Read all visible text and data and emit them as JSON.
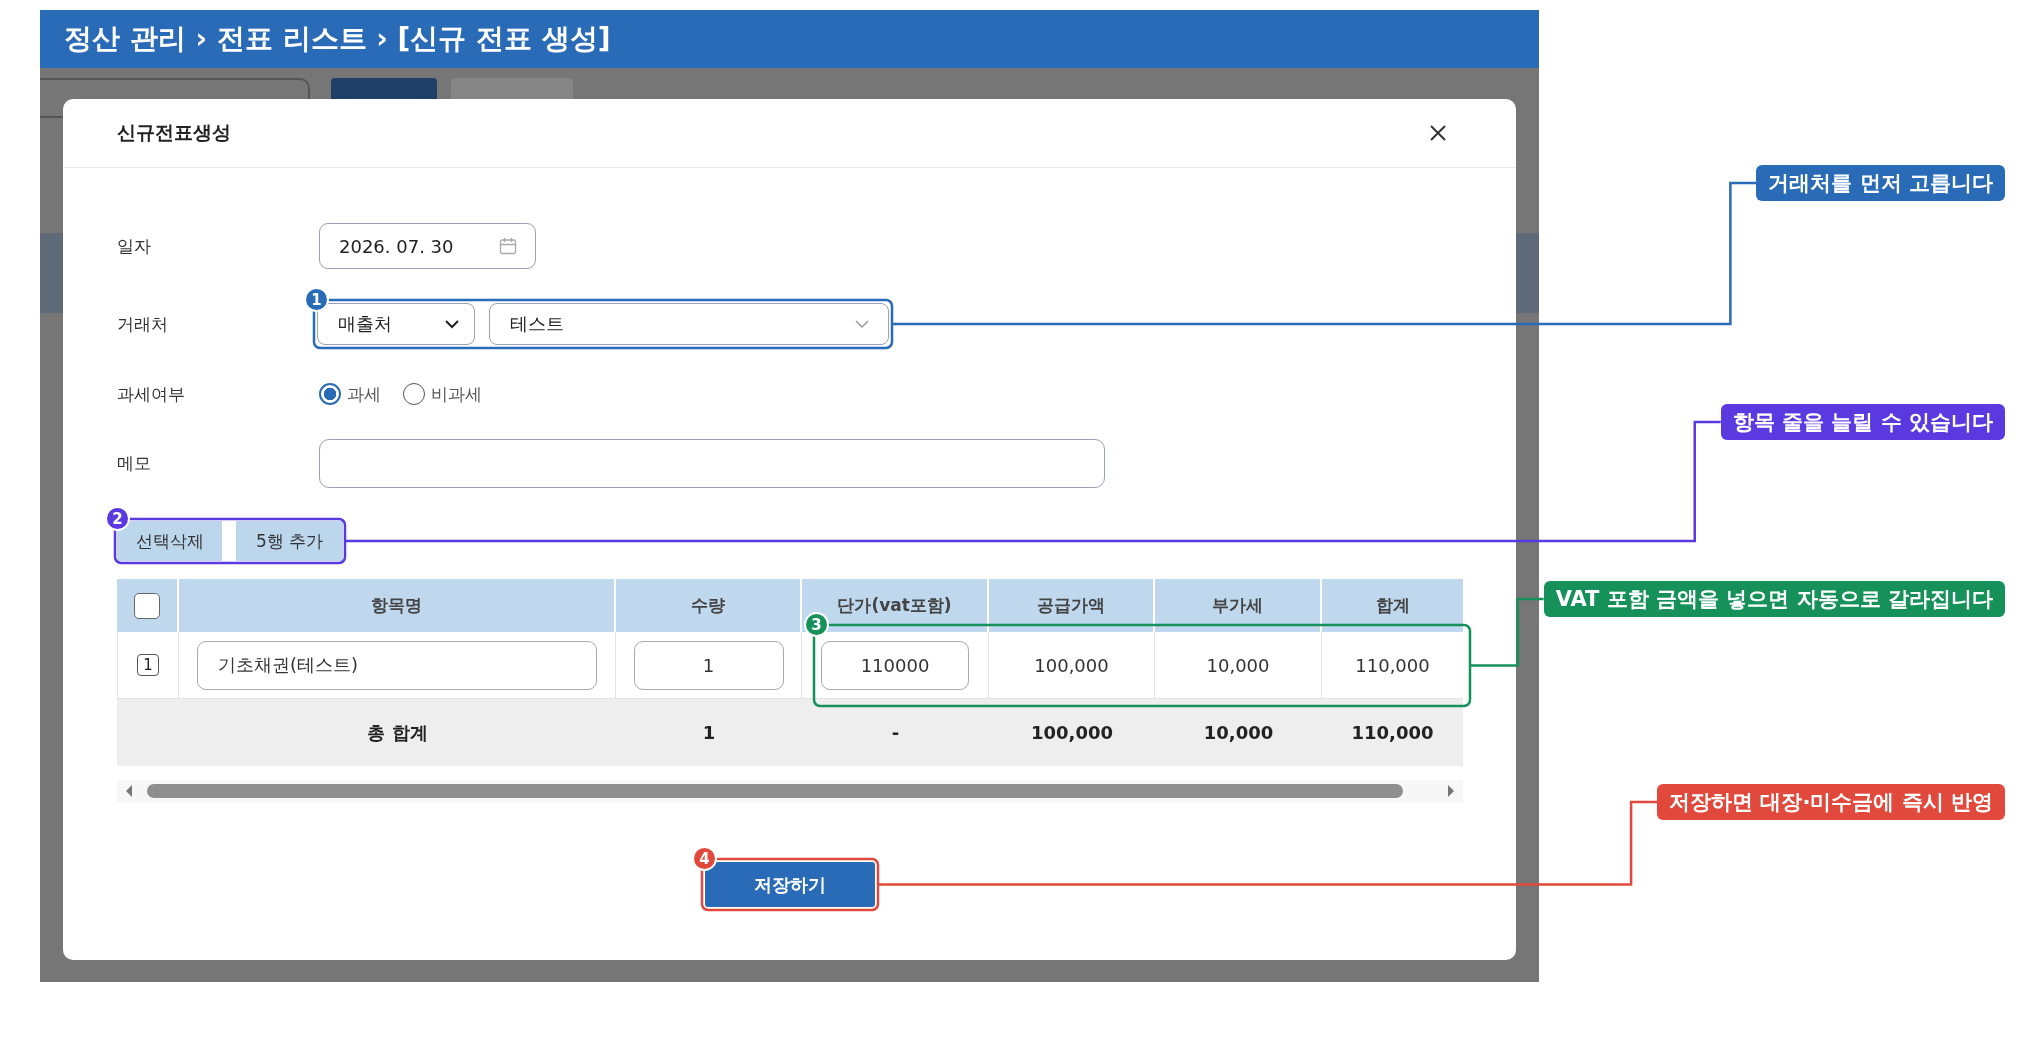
{
  "breadcrumb": "정산 관리 › 전표 리스트 › [신규 전표 생성]",
  "dialog": {
    "title": "신규전표생성",
    "fields": [
      {
        "kind": "date",
        "label": "일자",
        "value": "2026. 07. 30"
      },
      {
        "kind": "selects",
        "label": "거래처",
        "selects": [
          {
            "value": "매출처"
          },
          {
            "value": "테스트"
          }
        ]
      },
      {
        "kind": "radio",
        "label": "과세여부",
        "options": [
          {
            "label": "과세",
            "selected": true
          },
          {
            "label": "비과세",
            "selected": false
          }
        ]
      },
      {
        "kind": "text",
        "label": "메모"
      }
    ],
    "actions": [
      "선택삭제",
      "5행 추가"
    ],
    "table": {
      "select_all_checked": false,
      "columns": [
        "항목명",
        "수량",
        "단가(vat포함)",
        "공급가액",
        "부가세",
        "합계"
      ],
      "rows": [
        {
          "number": "1",
          "item": "기초채권(테스트)",
          "quantity": "1",
          "unit_price": "110000",
          "supply": "100,000",
          "vat": "10,000",
          "total": "110,000"
        }
      ],
      "summary": {
        "label": "총 합계",
        "values": [
          "1",
          "-",
          "100,000",
          "10,000",
          "110,000"
        ]
      }
    },
    "save_button": "저장하기"
  },
  "annotations": [
    {
      "number": "1",
      "kind": "partner",
      "text": "거래처를 먼저 고릅니다",
      "color": "#2a6bb8"
    },
    {
      "number": "2",
      "kind": "actions",
      "text": "항목 줄을 늘릴 수 있습니다",
      "color": "#5a3ae0"
    },
    {
      "number": "3",
      "kind": "amounts",
      "text": "VAT 포함 금액을 넣으면 자동으로 갈라집니다",
      "color": "#16915a"
    },
    {
      "number": "4",
      "kind": "save",
      "text": "저장하면 대장·미수금에 즉시 반영",
      "color": "#e0493b"
    }
  ]
}
